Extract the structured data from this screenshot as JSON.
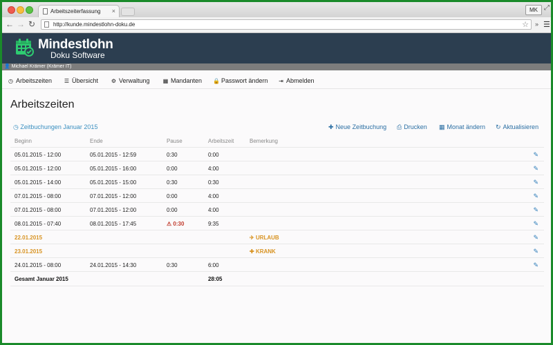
{
  "browser": {
    "tab_title": "Arbeitszeiterfassung",
    "tab_close": "×",
    "profile": "MK",
    "url": "http://kunde.mindestlohn-doku.de"
  },
  "app": {
    "brand_name": "Mindestlohn",
    "brand_sub": "Doku Software",
    "user_label": "Michael Krämer (Krämer IT)",
    "colors": {
      "header": "#2c3e50",
      "accent": "#3a8fc0",
      "warning": "#d89321"
    }
  },
  "menu": [
    {
      "label": "Arbeitszeiten",
      "icon": "clock-icon"
    },
    {
      "label": "Übersicht",
      "icon": "list-icon"
    },
    {
      "label": "Verwaltung",
      "icon": "cogs-icon"
    },
    {
      "label": "Mandanten",
      "icon": "building-icon"
    },
    {
      "label": "Passwort ändern",
      "icon": "lock-icon"
    },
    {
      "label": "Abmelden",
      "icon": "sign-out-icon"
    }
  ],
  "page_title": "Arbeitszeiten",
  "subheading": "Zeitbuchungen Januar 2015",
  "actions": {
    "new": "Neue Zeitbuchung",
    "print": "Drucken",
    "month": "Monat ändern",
    "refresh": "Aktualisieren"
  },
  "table": {
    "headers": {
      "begin": "Beginn",
      "end": "Ende",
      "pause": "Pause",
      "work": "Arbeitszeit",
      "note": "Bemerkung"
    },
    "rows": [
      {
        "begin": "05.01.2015 - 12:00",
        "end": "05.01.2015 - 12:59",
        "pause": "0:30",
        "work": "0:00",
        "note": ""
      },
      {
        "begin": "05.01.2015 - 12:00",
        "end": "05.01.2015 - 16:00",
        "pause": "0:00",
        "work": "4:00",
        "note": ""
      },
      {
        "begin": "05.01.2015 - 14:00",
        "end": "05.01.2015 - 15:00",
        "pause": "0:30",
        "work": "0:30",
        "note": ""
      },
      {
        "begin": "07.01.2015 - 08:00",
        "end": "07.01.2015 - 12:00",
        "pause": "0:00",
        "work": "4:00",
        "note": ""
      },
      {
        "begin": "07.01.2015 - 08:00",
        "end": "07.01.2015 - 12:00",
        "pause": "0:00",
        "work": "4:00",
        "note": ""
      },
      {
        "begin": "08.01.2015 - 07:40",
        "end": "08.01.2015 - 17:45",
        "pause": "0:30",
        "work": "9:35",
        "note": ""
      },
      {
        "begin": "22.01.2015",
        "end": "",
        "pause": "",
        "work": "",
        "note": "URLAUB"
      },
      {
        "begin": "23.01.2015",
        "end": "",
        "pause": "",
        "work": "",
        "note": "KRANK"
      },
      {
        "begin": "24.01.2015 - 08:00",
        "end": "24.01.2015 - 14:30",
        "pause": "0:30",
        "work": "6:00",
        "note": ""
      }
    ],
    "total_label": "Gesamt Januar 2015",
    "total_value": "28:05"
  }
}
